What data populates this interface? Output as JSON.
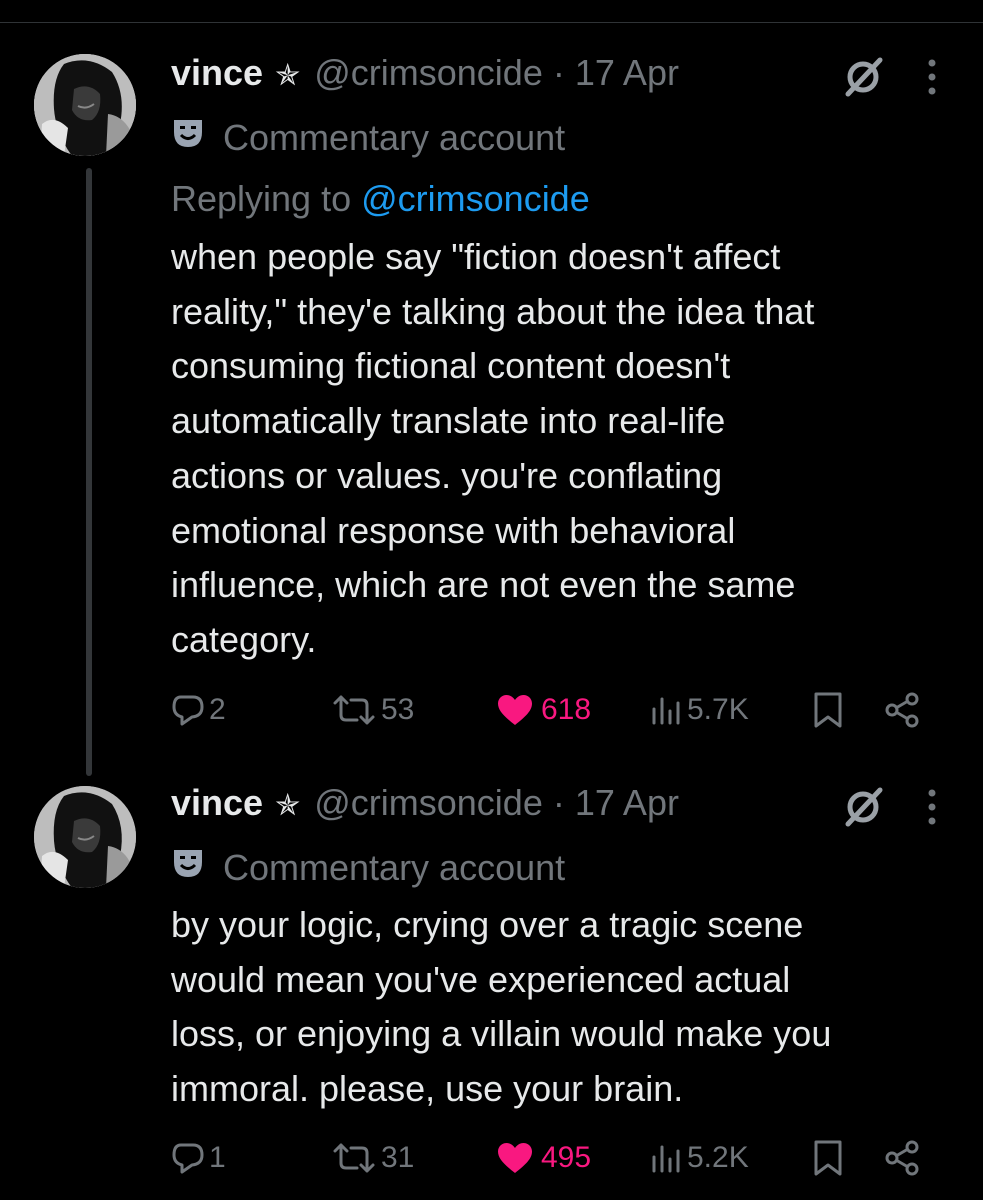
{
  "tweets": [
    {
      "name": "vince",
      "handle": "@crimsoncide",
      "separator": "·",
      "date": "17 Apr",
      "label": "Commentary account",
      "replying_prefix": "Replying to",
      "replying_to": "@crimsoncide",
      "text": "when people say \"fiction doesn't affect\nreality,\" they'e talking about the idea that\nconsuming fictional content doesn't\nautomatically translate into real-life\nactions or values. you're conflating\nemotional response with behavioral\ninfluence, which are not even the same\ncategory.",
      "replies": "2",
      "reposts": "53",
      "likes": "618",
      "views": "5.7K"
    },
    {
      "name": "vince",
      "handle": "@crimsoncide",
      "separator": "·",
      "date": "17 Apr",
      "label": "Commentary account",
      "text": "by your logic, crying over a tragic scene\nwould mean you've experienced actual\nloss, or enjoying a villain would make you\nimmoral. please, use your brain.",
      "replies": "1",
      "reposts": "31",
      "likes": "495",
      "views": "5.2K"
    }
  ],
  "colors": {
    "background": "#000000",
    "primary_text": "#e7e9ea",
    "secondary_text": "#71767b",
    "link": "#1d9bf0",
    "like": "#f91880"
  },
  "icons": [
    "pentagram-icon",
    "grok-icon",
    "more-icon",
    "mask-icon",
    "reply-icon",
    "repost-icon",
    "heart-icon",
    "views-icon",
    "bookmark-icon",
    "share-icon"
  ]
}
